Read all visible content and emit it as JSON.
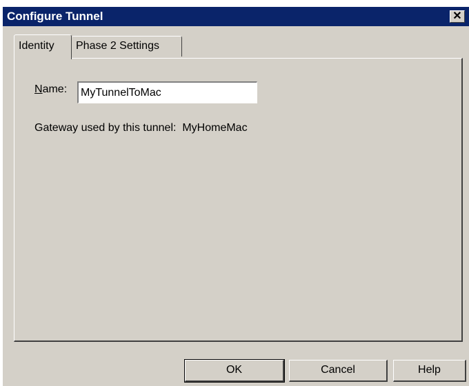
{
  "window": {
    "title": "Configure Tunnel",
    "close_label": "✕"
  },
  "tabs": [
    {
      "label": "Identity",
      "selected": true
    },
    {
      "label": "Phase 2 Settings",
      "selected": false
    }
  ],
  "identity": {
    "name_label_mnemonic": "N",
    "name_label_rest": "ame:",
    "name_value": "MyTunnelToMac",
    "gateway_text": "Gateway used by this tunnel:  MyHomeMac"
  },
  "buttons": {
    "ok": "OK",
    "cancel": "Cancel",
    "help": "Help"
  },
  "colors": {
    "titlebar": "#0a246a",
    "dialog_face": "#d4d0c8"
  }
}
